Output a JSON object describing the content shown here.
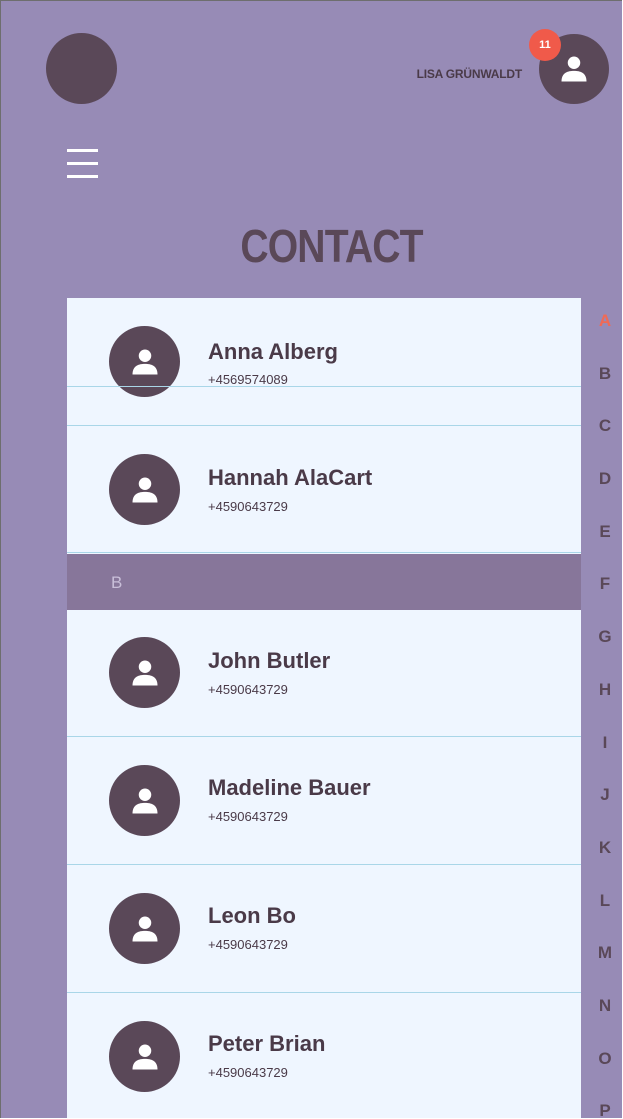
{
  "header": {
    "user_name": "LISA GRÜNWALDT",
    "notification_count": "11",
    "menu_icon": "hamburger-icon",
    "avatar_icon": "person-icon"
  },
  "page": {
    "title": "CONTACT"
  },
  "contacts": [
    {
      "name": "Anna Alberg",
      "phone": "+4569574089"
    },
    {
      "name": "Hannah AlaCart",
      "phone": "+4590643729"
    },
    {
      "name": "John Butler",
      "phone": "+4590643729"
    },
    {
      "name": "Madeline Bauer",
      "phone": "+4590643729"
    },
    {
      "name": "Leon Bo",
      "phone": "+4590643729"
    },
    {
      "name": "Peter Brian",
      "phone": "+4590643729"
    }
  ],
  "section_header": "B",
  "alphabet": [
    "A",
    "B",
    "C",
    "D",
    "E",
    "F",
    "G",
    "H",
    "I",
    "J",
    "K",
    "L",
    "M",
    "N",
    "O",
    "P"
  ],
  "active_letter": "A",
  "colors": {
    "background": "#978bb6",
    "dark": "#5a4858",
    "list_bg": "#eff6ff",
    "section_bg": "#87769a",
    "accent": "#f05a4a"
  }
}
